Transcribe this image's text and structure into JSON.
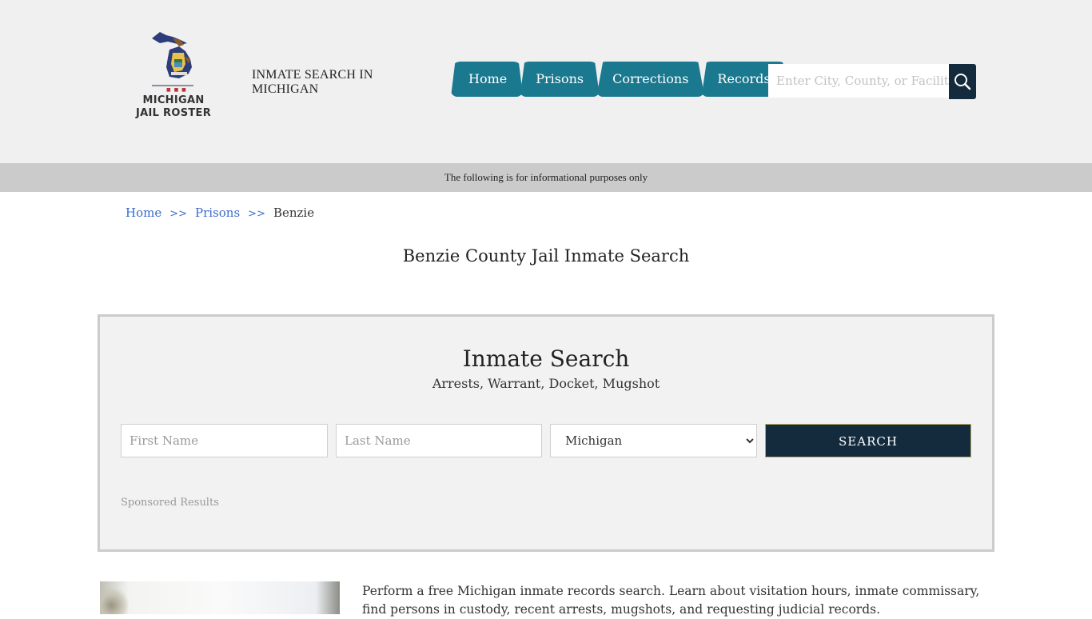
{
  "header": {
    "logo": {
      "line1": "MICHIGAN",
      "line2": "JAIL ROSTER",
      "dots": "■ ■ ■"
    },
    "tagline": "INMATE SEARCH IN MICHIGAN",
    "nav": [
      {
        "label": "Home"
      },
      {
        "label": "Prisons"
      },
      {
        "label": "Corrections"
      },
      {
        "label": "Records"
      }
    ],
    "search": {
      "placeholder": "Enter City, County, or Facility",
      "value": "",
      "icon": "search-icon"
    }
  },
  "info_bar": {
    "text": "The following is for informational purposes only"
  },
  "breadcrumb": {
    "items": [
      {
        "label": "Home"
      },
      {
        "label": "Prisons"
      },
      {
        "label": "Benzie"
      }
    ],
    "separator": ">>"
  },
  "page_title": "Benzie County Jail Inmate Search",
  "search_panel": {
    "title": "Inmate Search",
    "subtitle": "Arrests, Warrant, Docket, Mugshot",
    "first_name": {
      "placeholder": "First Name",
      "value": ""
    },
    "last_name": {
      "placeholder": "Last Name",
      "value": ""
    },
    "state": {
      "selected": "Michigan"
    },
    "button_label": "SEARCH",
    "sponsored": "Sponsored Results"
  },
  "intro": {
    "text": "Perform a free Michigan inmate records search. Learn about visitation hours, inmate commissary, find persons in custody, recent arrests, mugshots, and requesting judicial records."
  },
  "colors": {
    "nav_bg": "#1a788f",
    "dark_button": "#132b3d",
    "link": "#3c6bc9",
    "header_bg": "#f0f0f0",
    "info_bar_bg": "#cbcbcb"
  }
}
